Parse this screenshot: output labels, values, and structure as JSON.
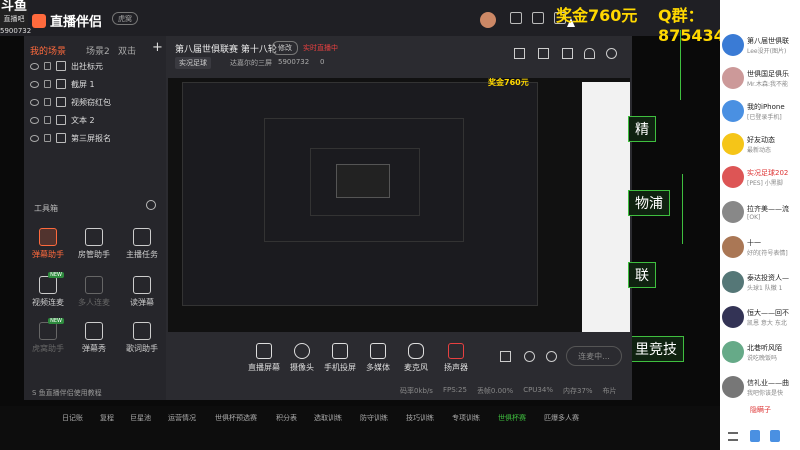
{
  "brand": {
    "logo_top": "斗鱼",
    "logo_mid": "直播吧",
    "logo_num": "5900732"
  },
  "app": {
    "name": "直播伴侣",
    "version_label": "虎窝"
  },
  "overlay": {
    "prize": "奖金760元",
    "qq_group": "Q群：875434520"
  },
  "scenes": {
    "tab1": "我的场景",
    "tab2": "场景2",
    "tab3": "双击",
    "add": "+",
    "items": [
      "出社标元",
      "截屏 1",
      "视频窃红包",
      "文本 2",
      "第三屏报名"
    ]
  },
  "tools": {
    "title": "工具箱",
    "items": [
      {
        "label": "弹幕助手",
        "badge": ""
      },
      {
        "label": "房管助手",
        "badge": ""
      },
      {
        "label": "主播任务",
        "badge": ""
      },
      {
        "label": "视频连麦",
        "badge": "NEW"
      },
      {
        "label": "多人连麦",
        "badge": ""
      },
      {
        "label": "读弹幕",
        "badge": ""
      },
      {
        "label": "虎窝助手",
        "badge": "NEW"
      },
      {
        "label": "弹幕秀",
        "badge": ""
      },
      {
        "label": "歌词助手",
        "badge": ""
      }
    ],
    "help": "S 鱼直播伴侣使用教程"
  },
  "main": {
    "title": "第八届世俱联赛 第十八轮",
    "edit_btn": "修改",
    "live_status": "实时直播中",
    "category": "实况足球",
    "anchor": "达嘉尔的三屏",
    "room": "5900732",
    "hot": "0"
  },
  "bottom": {
    "items": [
      "直播屏幕",
      "摄像头",
      "手机投屏",
      "多媒体",
      "麦克风",
      "扬声器"
    ],
    "start_btn": "连麦中...",
    "status": [
      "码率0kb/s",
      "FPS:25",
      "丢帧0.00%",
      "CPU34%",
      "内存37%",
      "布片"
    ]
  },
  "taskbar": {
    "tabs": [
      "日记账",
      "复程",
      "巨星池",
      "运营情况",
      "世俱杯预选赛",
      "积分表",
      "选取训练",
      "防守训练",
      "技巧训练",
      "专项训练",
      "世俱杯赛",
      "匹爆多人赛"
    ]
  },
  "chat": {
    "rows": [
      {
        "name": "第八届世俱联",
        "sub": "Lee没开(图片)",
        "color": "#3a7bd5"
      },
      {
        "name": "世俱国足俱乐",
        "sub": "Mr.木森:我不能",
        "color": "#c99"
      },
      {
        "name": "我的iPhone",
        "sub": "[已登录手机]",
        "color": "#4a90e2"
      },
      {
        "name": "好友动态",
        "sub": "最新动态",
        "color": "#f5c518"
      },
      {
        "name": "实况足球202",
        "sub": "[PES] 小黑脚",
        "color": "#d55"
      },
      {
        "name": "拉齐美——流",
        "sub": "[OK]",
        "color": "#888"
      },
      {
        "name": "十一",
        "sub": "好的[符号表情]",
        "color": "#a75"
      },
      {
        "name": "泰达投资人—",
        "sub": "头球1 队徽 1",
        "color": "#577"
      },
      {
        "name": "恒大——回不",
        "sub": "凯恩 意大 东北",
        "color": "#335"
      },
      {
        "name": "北巷听风陌",
        "sub": "说吃晚饭吗",
        "color": "#6a8"
      },
      {
        "name": "信礼业——曲",
        "sub": "我吧你该是快",
        "color": "#777"
      },
      {
        "name": "隐瞒子",
        "sub": "",
        "color": "#b44"
      }
    ]
  },
  "screen_words": [
    "精",
    "物浦",
    "联",
    "里竞技"
  ]
}
